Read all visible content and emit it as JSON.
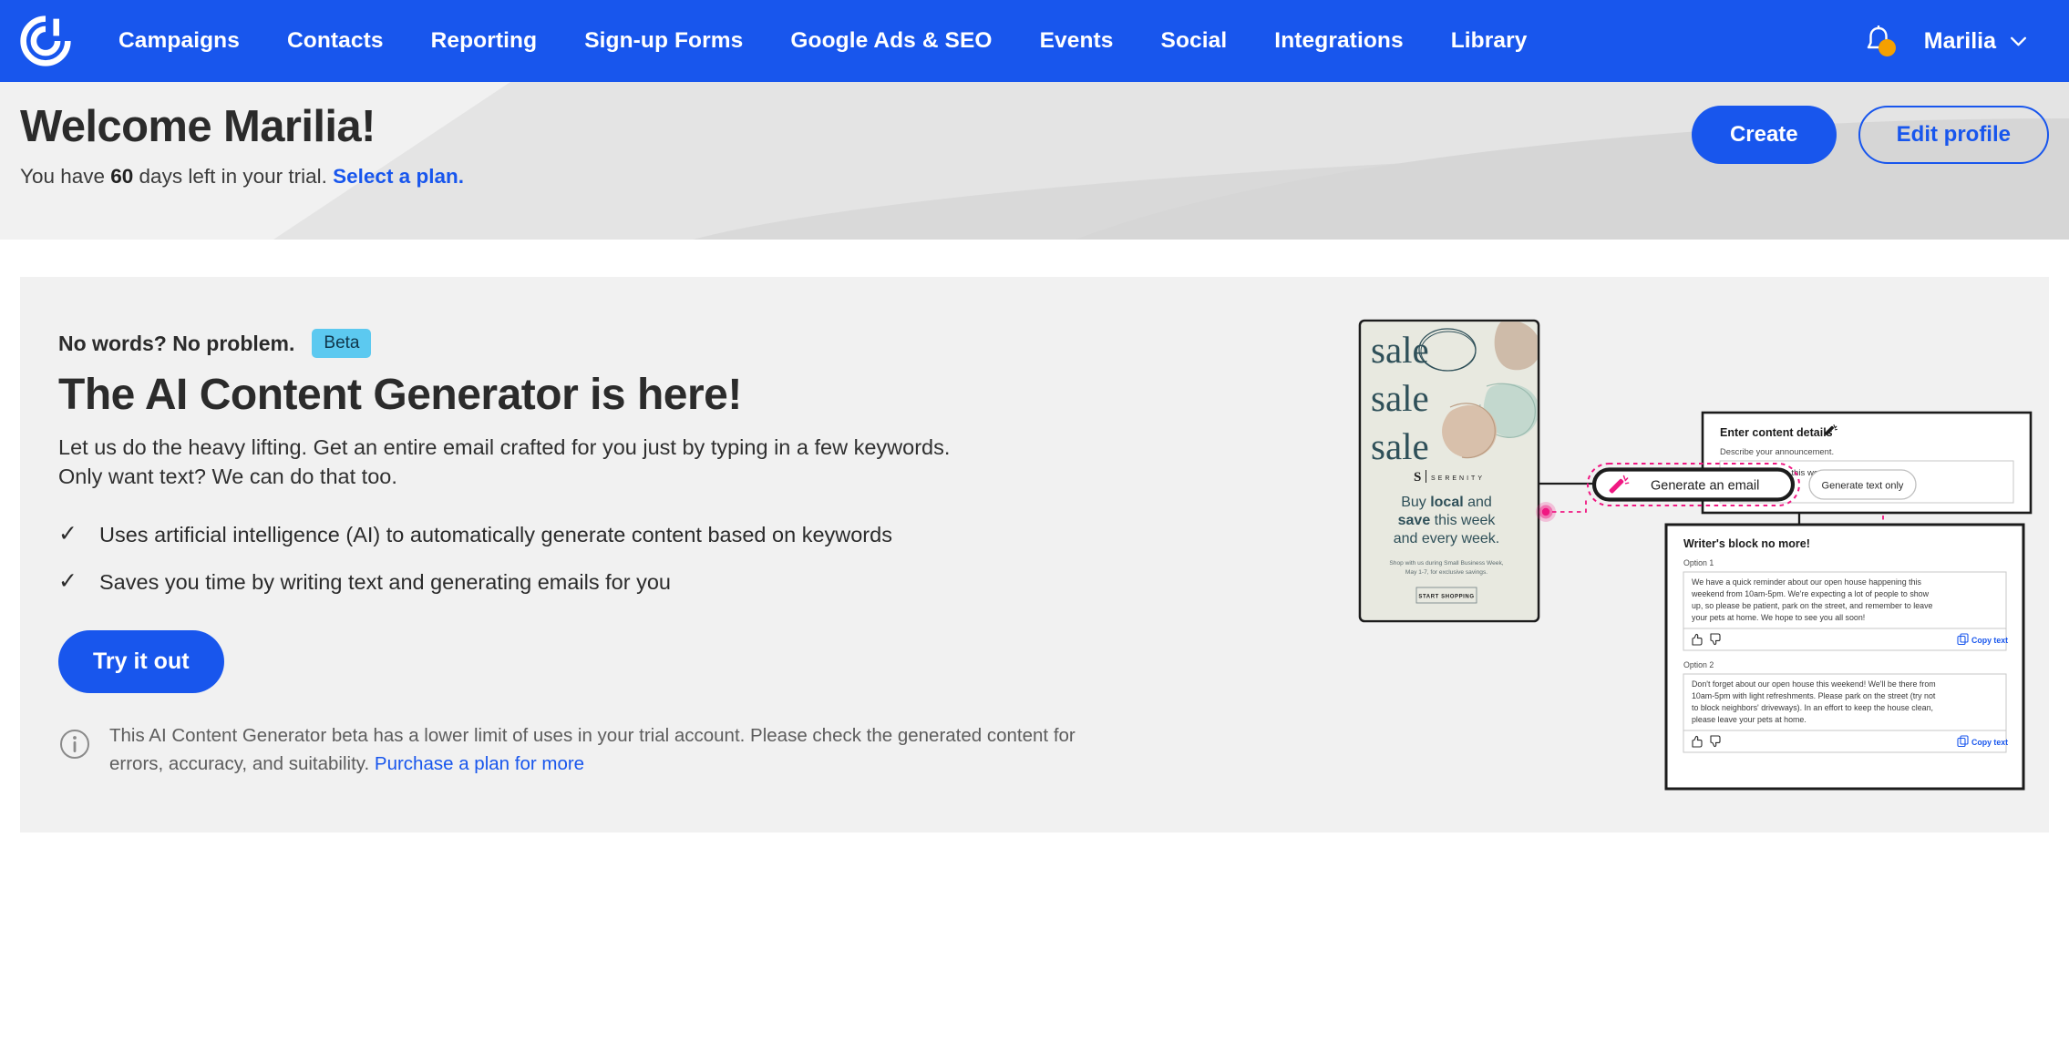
{
  "nav": {
    "logo_icon": "constant-contact-logo",
    "links": [
      {
        "label": "Campaigns"
      },
      {
        "label": "Contacts"
      },
      {
        "label": "Reporting"
      },
      {
        "label": "Sign-up Forms"
      },
      {
        "label": "Google Ads & SEO"
      },
      {
        "label": "Events"
      },
      {
        "label": "Social"
      },
      {
        "label": "Integrations"
      },
      {
        "label": "Library"
      }
    ],
    "notifications_icon": "bell-icon",
    "has_notification_dot": true,
    "user": "Marilia",
    "user_chevron_icon": "chevron-down-icon",
    "bg_color": "#1856ED"
  },
  "hero": {
    "title": "Welcome Marilia!",
    "trial_prefix": "You have ",
    "trial_days": "60",
    "trial_suffix": " days left in your trial. ",
    "trial_link": "Select a plan.",
    "create_label": "Create",
    "edit_profile_label": "Edit profile",
    "accent_color": "#1856ED",
    "bg_color": "#F1F1F1"
  },
  "promo": {
    "eyebrow": "No words? No problem.",
    "badge": "Beta",
    "badge_color": "#5CC9F0",
    "headline": "The AI Content Generator is here!",
    "lede": "Let us do the heavy lifting. Get an entire email crafted for you just by typing in a few keywords. Only want text? We can do that too.",
    "bullets": [
      "Uses artificial intelligence (AI) to automatically generate content based on keywords",
      "Saves you time by writing text and generating emails for you"
    ],
    "check_icon": "check-icon",
    "cta_label": "Try it out",
    "info_icon": "info-circle-icon",
    "disclaimer": "This AI Content Generator beta has a lower limit of uses in your trial account. Please check the generated content for errors, accuracy, and suitability. ",
    "disclaimer_link": "Purchase a plan for more"
  },
  "illustration": {
    "poster": {
      "sale_lines": [
        "sale",
        "sale",
        "sale"
      ],
      "brand_mark": "S",
      "brand_name": "S E R E N I T Y",
      "tagline_line1_a": "Buy ",
      "tagline_line1_b": "local",
      "tagline_line1_c": " and",
      "tagline_line2_a": "save",
      "tagline_line2_b": " this week",
      "tagline_line3": "and every week.",
      "fineprint_line1": "Shop with us during Small Business Week,",
      "fineprint_line2": "May 1-7, for exclusive savings.",
      "button": "START SHOPPING"
    },
    "content_panel": {
      "title": "Enter content details",
      "wand_icon": "magic-wand-icon",
      "field_label": "Describe your announcement.",
      "field_value": "Sale happening this week!"
    },
    "generate_email_button": {
      "label": "Generate an email",
      "icon": "magic-wand-icon",
      "highlight_color": "#F01882"
    },
    "generate_text_button": {
      "label": "Generate text only"
    },
    "results_panel": {
      "title": "Writer's block no more!",
      "options": [
        {
          "label": "Option 1",
          "text": "We have a quick reminder about our open house happening this weekend from 10am-5pm. We're expecting a lot of people to show up, so please be patient, park on the street, and remember to leave your pets at home. We hope to see you all soon!",
          "thumbs_up_icon": "thumbs-up-icon",
          "thumbs_down_icon": "thumbs-down-icon",
          "copy_icon": "copy-icon",
          "copy_label": "Copy text"
        },
        {
          "label": "Option 2",
          "text": "Don't forget about our open house this weekend! We'll be there from 10am-5pm with light refreshments. Please park on the street (try not to block neighbors' driveways). In an effort to keep the house clean, please leave your pets at home.",
          "thumbs_up_icon": "thumbs-up-icon",
          "thumbs_down_icon": "thumbs-down-icon",
          "copy_icon": "copy-icon",
          "copy_label": "Copy text"
        }
      ]
    }
  }
}
